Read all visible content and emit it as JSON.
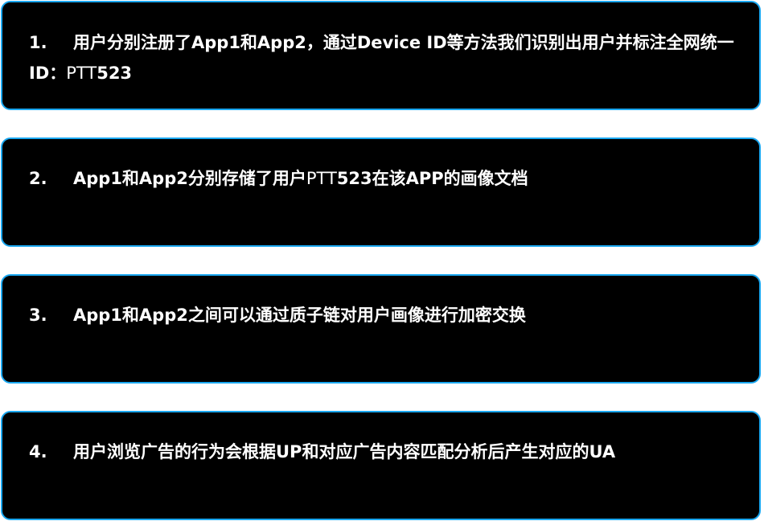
{
  "colors": {
    "card_background": "#000000",
    "card_border": "#1aa7f0",
    "text": "#ffffff"
  },
  "steps": [
    {
      "number": "1.",
      "text_part1": "用户分别注册了App1和App2，通过Device ID等方法我们识别出用户并标注全网统一ID：",
      "text_part2": "PTT",
      "text_part3": "523"
    },
    {
      "number": "2.",
      "text_part1": "App1和App2分别存储了用户",
      "text_part2": "PTT",
      "text_part3": "523在该APP的画像文档"
    },
    {
      "number": "3.",
      "text_part1": "App1和App2之间可以通过质子链对用户画像进行加密交换"
    },
    {
      "number": "4.",
      "text_part1": "用户浏览广告的行为会根据UP和对应广告内容匹配分析后产生对应的UA"
    }
  ]
}
